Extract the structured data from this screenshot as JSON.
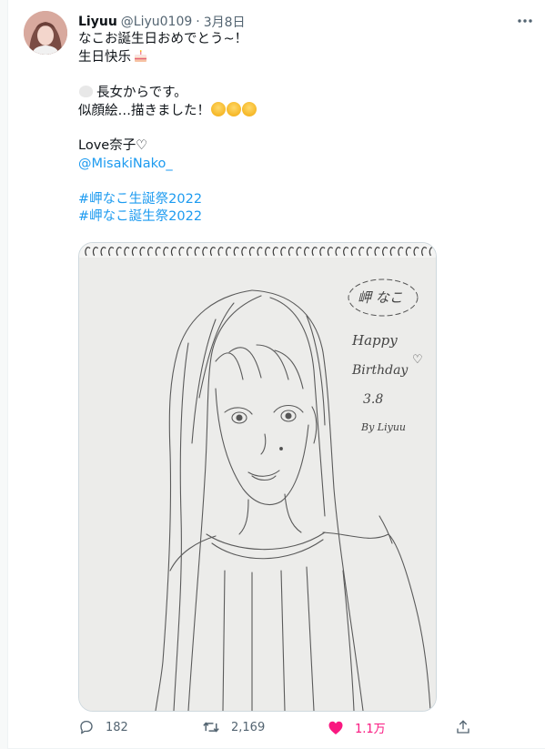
{
  "tweet": {
    "author_name": "Liyuu",
    "author_handle": "@Liyu0109",
    "separator": "·",
    "date": "3月8日",
    "lines": {
      "l1": "なこお誕生日おめでとう~！",
      "l2": "生日快乐",
      "l3": "長女からです。",
      "l4": "似顔絵…描きました！",
      "l5": "Love奈子♡",
      "mention": "@MisakiNako_",
      "hashtag1": "#岬なこ生誕祭2022",
      "hashtag2": "#岬なこ誕生祭2022"
    },
    "icons": {
      "more": "more-icon",
      "reply": "reply-icon",
      "retweet": "retweet-icon",
      "like": "heart-icon",
      "share": "share-icon"
    }
  },
  "image": {
    "sketch_text": {
      "name": "岬 なこ",
      "happy": "Happy",
      "birthday": "Birthday",
      "heart": "♡",
      "date": "3.8",
      "by": "By Liyuu"
    }
  },
  "actions": {
    "reply_count": "182",
    "retweet_count": "2,169",
    "like_count": "1.1万"
  },
  "colors": {
    "accent": "#1d9bf0",
    "like": "#f91880",
    "text_secondary": "#536471"
  }
}
